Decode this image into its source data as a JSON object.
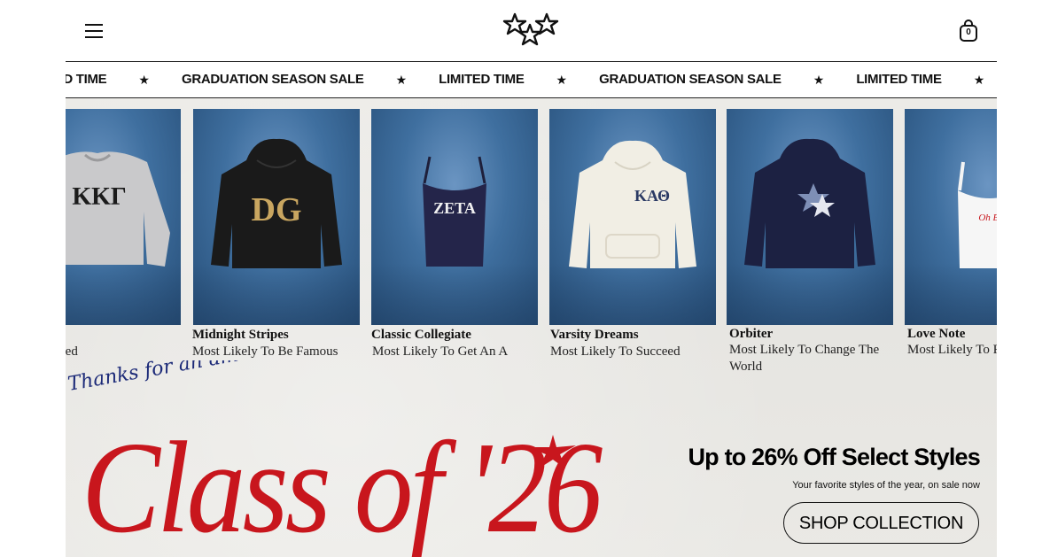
{
  "header": {
    "menu_icon": "hamburger-icon",
    "logo_icon": "stars-logo-icon",
    "cart_icon": "shopping-bag-icon",
    "cart_count": "0"
  },
  "marquee": {
    "items": [
      "LIMITED TIME",
      "GRADUATION SEASON SALE",
      "LIMITED TIME",
      "GRADUATION SEASON SALE",
      "LIMITED TIME"
    ],
    "separator": "★"
  },
  "products": [
    {
      "name": "",
      "desc": "ssed"
    },
    {
      "name": "Midnight Stripes",
      "desc": "Most Likely To Be Famous"
    },
    {
      "name": "Classic Collegiate",
      "desc": "Most Likely To Get An A"
    },
    {
      "name": "Varsity Dreams",
      "desc": "Most Likely To Succeed"
    },
    {
      "name": "Orbiter",
      "desc": "Most Likely To Change The World"
    },
    {
      "name": "Love Note",
      "desc": "Most Likely To F"
    }
  ],
  "garment_prints": {
    "kkg": "ΚΚΓ",
    "dg": "DG",
    "zeta": "ZETA",
    "kat": "ΚΑΘ",
    "love": "Oh Boy"
  },
  "hero": {
    "script": "Thanks for an amazing year",
    "headline": "Class of '26",
    "offer_title": "Up to 26% Off Select Styles",
    "offer_sub": "Your favorite styles of the year, on sale now",
    "cta": "SHOP COLLECTION"
  },
  "colors": {
    "accent_red": "#c8161d",
    "card_blue": "#3f6f9f"
  }
}
